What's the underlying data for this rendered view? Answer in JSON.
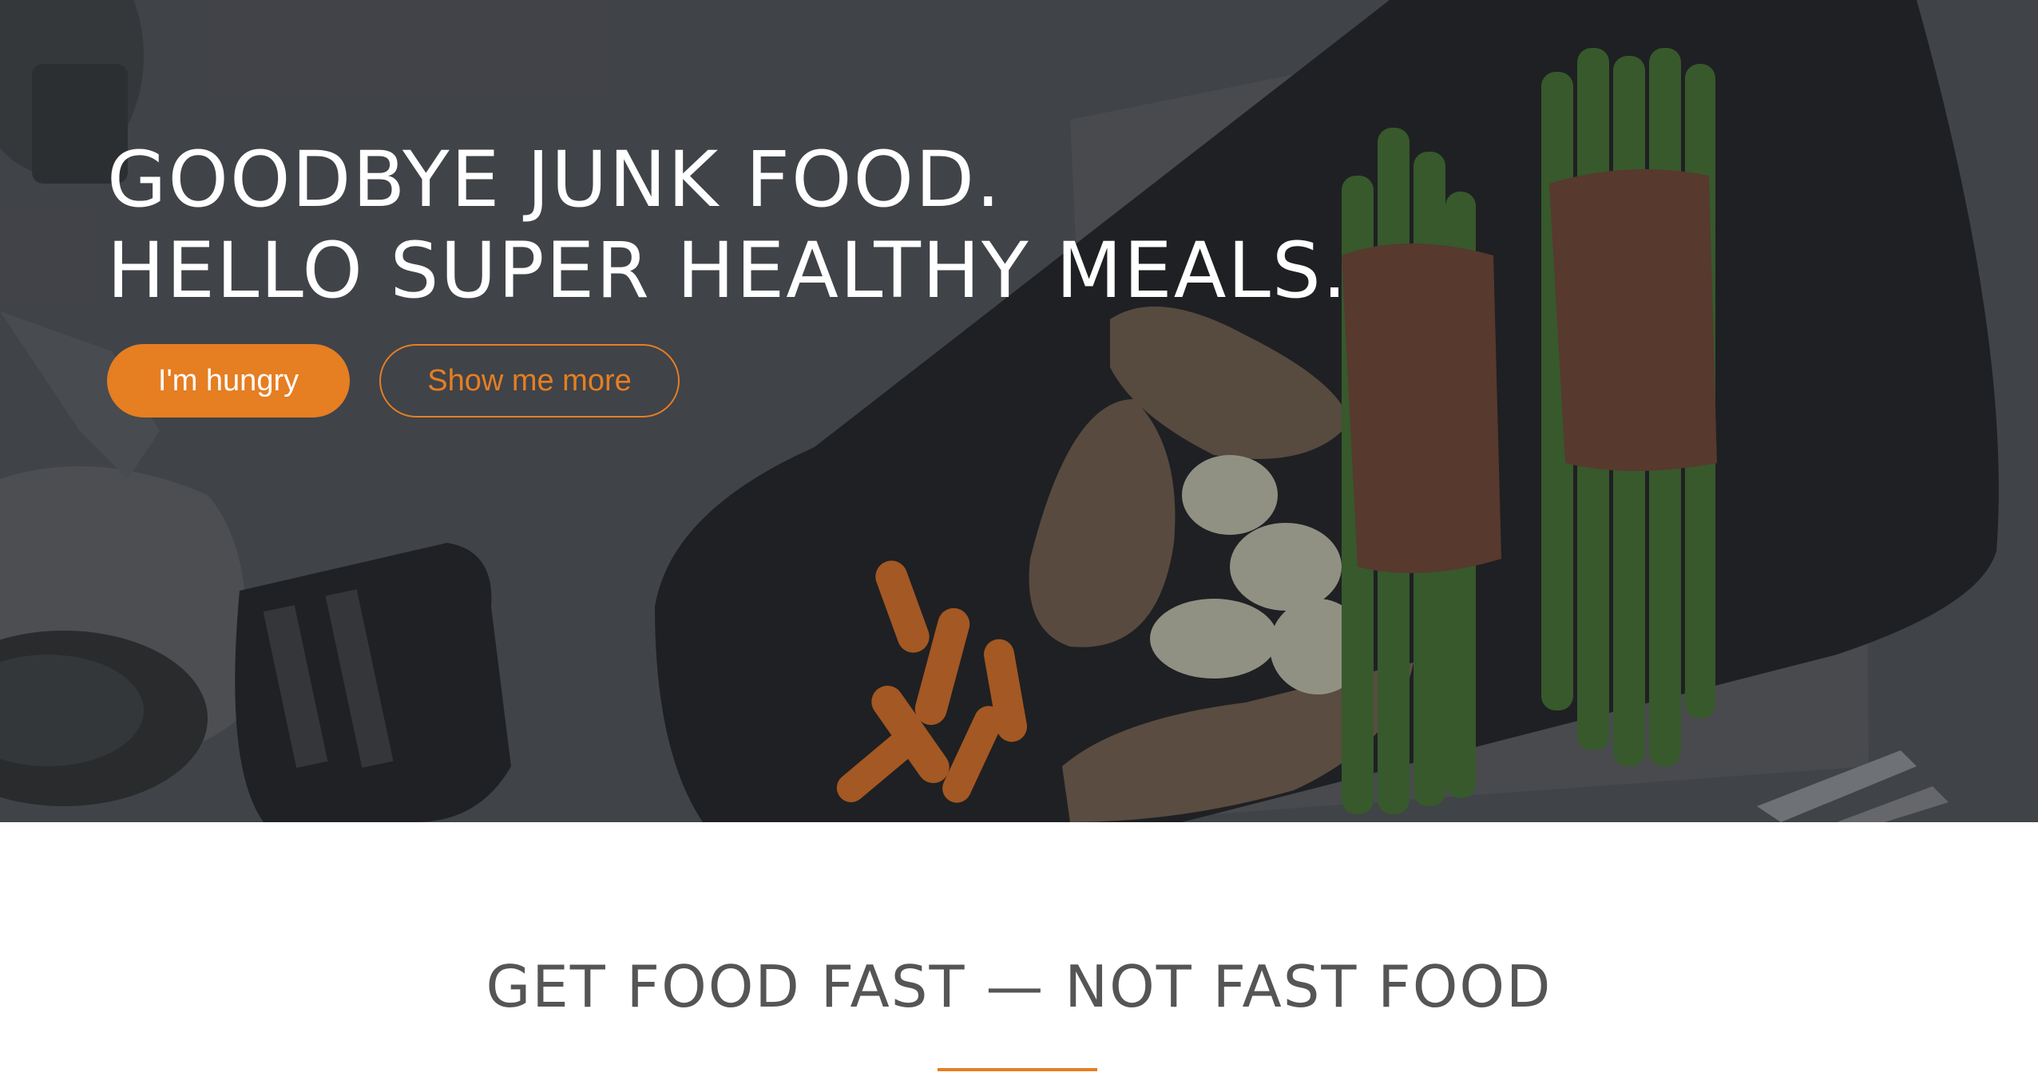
{
  "hero": {
    "headline_line1": "GOODBYE JUNK FOOD.",
    "headline_line2": "HELLO SUPER HEALTHY MEALS.",
    "primary_button": "I'm hungry",
    "secondary_button": "Show me more"
  },
  "section": {
    "title": "GET FOOD FAST — NOT FAST FOOD"
  },
  "colors": {
    "accent": "#e67e22",
    "hero_dark": "#46494e",
    "text_dark": "#555555"
  }
}
